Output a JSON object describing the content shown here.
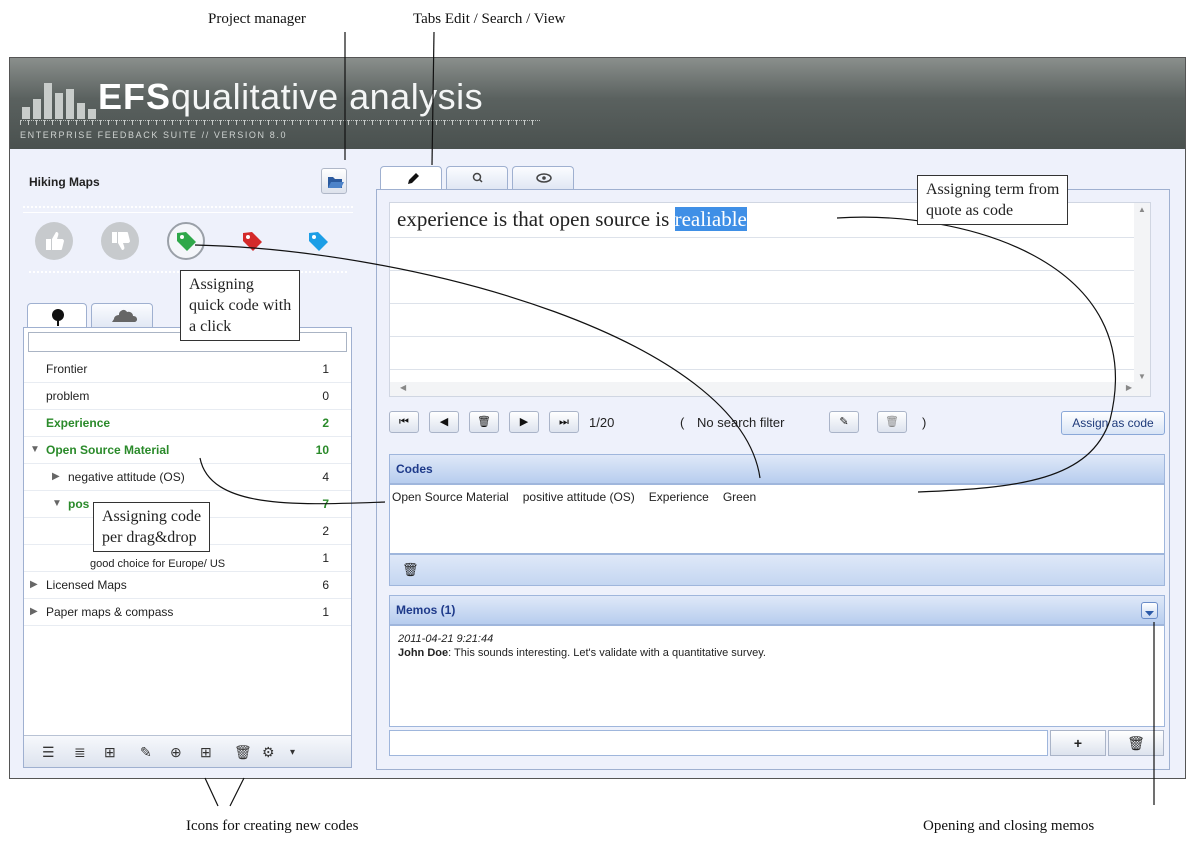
{
  "annotations": {
    "project_manager": "Project manager",
    "tabs": "Tabs Edit / Search / View",
    "icons_new_codes": "Icons for creating new codes",
    "opening_memos": "Opening and closing memos",
    "assign_term": "Assigning term from quote as code",
    "assign_term_l1": "Assigning term from",
    "assign_term_l2": "quote as code",
    "quick_code_l1": "Assigning",
    "quick_code_l2": "quick code with",
    "quick_code_l3": "a click",
    "dragdrop_l1": "Assigning code",
    "dragdrop_l2": "per drag&drop"
  },
  "header": {
    "brand": "EFS",
    "title": "qualitative analysis",
    "subtitle": "ENTERPRISE FEEDBACK SUITE // VERSION 8.0"
  },
  "project": {
    "name": "Hiking Maps"
  },
  "quick_codes": [
    "thumbs-up",
    "thumbs-down",
    "tag-green",
    "tag-red",
    "tag-blue"
  ],
  "tree": {
    "rows": [
      {
        "label": "Frontier",
        "count": "1"
      },
      {
        "label": "problem",
        "count": "0"
      },
      {
        "label": "Experience",
        "count": "2"
      },
      {
        "label": "Open Source Material",
        "count": "10"
      },
      {
        "label": "negative attitude (OS)",
        "count": "4"
      },
      {
        "label": "pos",
        "count": "7"
      },
      {
        "label": "",
        "count": "2"
      },
      {
        "label": "good choice for Europe/ US",
        "count": "1"
      },
      {
        "label": "Licensed Maps",
        "count": "6"
      },
      {
        "label": "Paper maps & compass",
        "count": "1"
      }
    ]
  },
  "quote": {
    "text_before": "experience is that open source is ",
    "selected": "realiable"
  },
  "nav": {
    "position": "1/20",
    "filter_open": "(",
    "filter_text": "No search filter",
    "filter_close": ")",
    "assign_label": "Assign as code"
  },
  "codes": {
    "title": "Codes",
    "items": [
      "Open Source Material",
      "positive attitude (OS)",
      "Experience",
      "Green"
    ]
  },
  "memos": {
    "title": "Memos (1)",
    "date": "2011-04-21 9:21:44",
    "author": "John Doe",
    "text": ": This sounds interesting. Let's validate with a quantitative survey.",
    "add_label": "+"
  },
  "colors": {
    "header": "#5a615f",
    "panel_bg": "#eef1fb",
    "accent_blue": "#1e3a8a",
    "green": "#2a8a2a",
    "selection": "#3f8fe6"
  }
}
